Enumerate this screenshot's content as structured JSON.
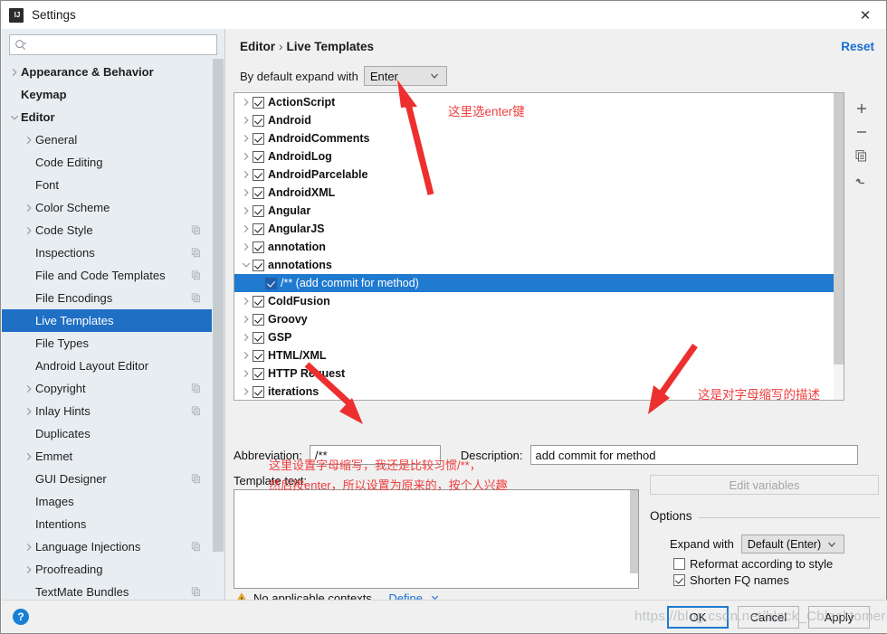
{
  "window": {
    "title": "Settings",
    "app_icon": "intellij-icon",
    "close_icon": "close-icon"
  },
  "search": {
    "placeholder": "",
    "value": "",
    "icon": "search-icon"
  },
  "sidebar": {
    "items": [
      {
        "label": "Appearance & Behavior",
        "indent": 0,
        "bold": true,
        "twisty": "collapsed",
        "copy": false,
        "selected": false
      },
      {
        "label": "Keymap",
        "indent": 0,
        "bold": true,
        "twisty": "none",
        "copy": false,
        "selected": false
      },
      {
        "label": "Editor",
        "indent": 0,
        "bold": true,
        "twisty": "expanded",
        "copy": false,
        "selected": false
      },
      {
        "label": "General",
        "indent": 1,
        "bold": false,
        "twisty": "collapsed",
        "copy": false,
        "selected": false
      },
      {
        "label": "Code Editing",
        "indent": 1,
        "bold": false,
        "twisty": "none",
        "copy": false,
        "selected": false
      },
      {
        "label": "Font",
        "indent": 1,
        "bold": false,
        "twisty": "none",
        "copy": false,
        "selected": false
      },
      {
        "label": "Color Scheme",
        "indent": 1,
        "bold": false,
        "twisty": "collapsed",
        "copy": false,
        "selected": false
      },
      {
        "label": "Code Style",
        "indent": 1,
        "bold": false,
        "twisty": "collapsed",
        "copy": true,
        "selected": false
      },
      {
        "label": "Inspections",
        "indent": 1,
        "bold": false,
        "twisty": "none",
        "copy": true,
        "selected": false
      },
      {
        "label": "File and Code Templates",
        "indent": 1,
        "bold": false,
        "twisty": "none",
        "copy": true,
        "selected": false
      },
      {
        "label": "File Encodings",
        "indent": 1,
        "bold": false,
        "twisty": "none",
        "copy": true,
        "selected": false
      },
      {
        "label": "Live Templates",
        "indent": 1,
        "bold": false,
        "twisty": "none",
        "copy": false,
        "selected": true
      },
      {
        "label": "File Types",
        "indent": 1,
        "bold": false,
        "twisty": "none",
        "copy": false,
        "selected": false
      },
      {
        "label": "Android Layout Editor",
        "indent": 1,
        "bold": false,
        "twisty": "none",
        "copy": false,
        "selected": false
      },
      {
        "label": "Copyright",
        "indent": 1,
        "bold": false,
        "twisty": "collapsed",
        "copy": true,
        "selected": false
      },
      {
        "label": "Inlay Hints",
        "indent": 1,
        "bold": false,
        "twisty": "collapsed",
        "copy": true,
        "selected": false
      },
      {
        "label": "Duplicates",
        "indent": 1,
        "bold": false,
        "twisty": "none",
        "copy": false,
        "selected": false
      },
      {
        "label": "Emmet",
        "indent": 1,
        "bold": false,
        "twisty": "collapsed",
        "copy": false,
        "selected": false
      },
      {
        "label": "GUI Designer",
        "indent": 1,
        "bold": false,
        "twisty": "none",
        "copy": true,
        "selected": false
      },
      {
        "label": "Images",
        "indent": 1,
        "bold": false,
        "twisty": "none",
        "copy": false,
        "selected": false
      },
      {
        "label": "Intentions",
        "indent": 1,
        "bold": false,
        "twisty": "none",
        "copy": false,
        "selected": false
      },
      {
        "label": "Language Injections",
        "indent": 1,
        "bold": false,
        "twisty": "collapsed",
        "copy": true,
        "selected": false
      },
      {
        "label": "Proofreading",
        "indent": 1,
        "bold": false,
        "twisty": "collapsed",
        "copy": false,
        "selected": false
      },
      {
        "label": "TextMate Bundles",
        "indent": 1,
        "bold": false,
        "twisty": "none",
        "copy": true,
        "selected": false
      }
    ]
  },
  "main": {
    "breadcrumb": {
      "parent": "Editor",
      "separator": "›",
      "current": "Live Templates"
    },
    "reset_label": "Reset",
    "expand_with": {
      "label": "By default expand with",
      "value": "Enter"
    },
    "template_tree": [
      {
        "label": "ActionScript",
        "indent": 0,
        "twisty": "collapsed",
        "checked": true,
        "selected": false
      },
      {
        "label": "Android",
        "indent": 0,
        "twisty": "collapsed",
        "checked": true,
        "selected": false
      },
      {
        "label": "AndroidComments",
        "indent": 0,
        "twisty": "collapsed",
        "checked": true,
        "selected": false
      },
      {
        "label": "AndroidLog",
        "indent": 0,
        "twisty": "collapsed",
        "checked": true,
        "selected": false
      },
      {
        "label": "AndroidParcelable",
        "indent": 0,
        "twisty": "collapsed",
        "checked": true,
        "selected": false
      },
      {
        "label": "AndroidXML",
        "indent": 0,
        "twisty": "collapsed",
        "checked": true,
        "selected": false
      },
      {
        "label": "Angular",
        "indent": 0,
        "twisty": "collapsed",
        "checked": true,
        "selected": false
      },
      {
        "label": "AngularJS",
        "indent": 0,
        "twisty": "collapsed",
        "checked": true,
        "selected": false
      },
      {
        "label": "annotation",
        "indent": 0,
        "twisty": "collapsed",
        "checked": true,
        "selected": false
      },
      {
        "label": "annotations",
        "indent": 0,
        "twisty": "expanded",
        "checked": true,
        "selected": false
      },
      {
        "label": "/** (add commit for method)",
        "indent": 1,
        "twisty": "none",
        "checked": true,
        "selected": true
      },
      {
        "label": "ColdFusion",
        "indent": 0,
        "twisty": "collapsed",
        "checked": true,
        "selected": false
      },
      {
        "label": "Groovy",
        "indent": 0,
        "twisty": "collapsed",
        "checked": true,
        "selected": false
      },
      {
        "label": "GSP",
        "indent": 0,
        "twisty": "collapsed",
        "checked": true,
        "selected": false
      },
      {
        "label": "HTML/XML",
        "indent": 0,
        "twisty": "collapsed",
        "checked": true,
        "selected": false
      },
      {
        "label": "HTTP Request",
        "indent": 0,
        "twisty": "collapsed",
        "checked": true,
        "selected": false
      },
      {
        "label": "iterations",
        "indent": 0,
        "twisty": "collapsed",
        "checked": true,
        "selected": false
      }
    ],
    "toolbar": [
      {
        "name": "add-icon",
        "glyph": "+"
      },
      {
        "name": "remove-icon",
        "glyph": "−"
      },
      {
        "name": "copy-icon",
        "glyph": "copy"
      },
      {
        "name": "revert-icon",
        "glyph": "undo"
      }
    ],
    "abbreviation": {
      "label": "Abbreviation:",
      "value": "/**"
    },
    "description": {
      "label": "Description:",
      "value": "add commit for method"
    },
    "template_text": {
      "label": "Template text:",
      "value": ""
    },
    "context": {
      "warning_icon": "warning-icon",
      "text": "No applicable contexts.",
      "define_label": "Define"
    },
    "edit_variables_label": "Edit variables",
    "options": {
      "title": "Options",
      "expand_with_label": "Expand with",
      "expand_with_value": "Default (Enter)",
      "reformat": {
        "label": "Reformat according to style",
        "checked": false
      },
      "shorten": {
        "label": "Shorten FQ names",
        "checked": true
      }
    }
  },
  "footer": {
    "help_label": "?",
    "ok_label": "OK",
    "cancel_label": "Cancel",
    "apply_label": "Apply"
  },
  "annotations": {
    "enter_note": "这里选enter键",
    "description_note": "这是对字母缩写的描述",
    "template_note_line1": "这里设置字母缩写，我还是比较习惯/**，",
    "template_note_line2": "然后按enter，所以设置为原来的，按个人兴趣",
    "color": "#ef3e3e"
  },
  "watermark": {
    "text": "https://blog.csdn.net/black_Cblacktomer"
  },
  "colors": {
    "selection_blue": "#1f6fc4",
    "tree_selection_blue": "#1f7ad0",
    "link_blue": "#1a6fd4",
    "sidebar_bg": "#e8edf1",
    "panel_bg": "#f0f0f0",
    "annotation_red": "#ef3e3e"
  }
}
